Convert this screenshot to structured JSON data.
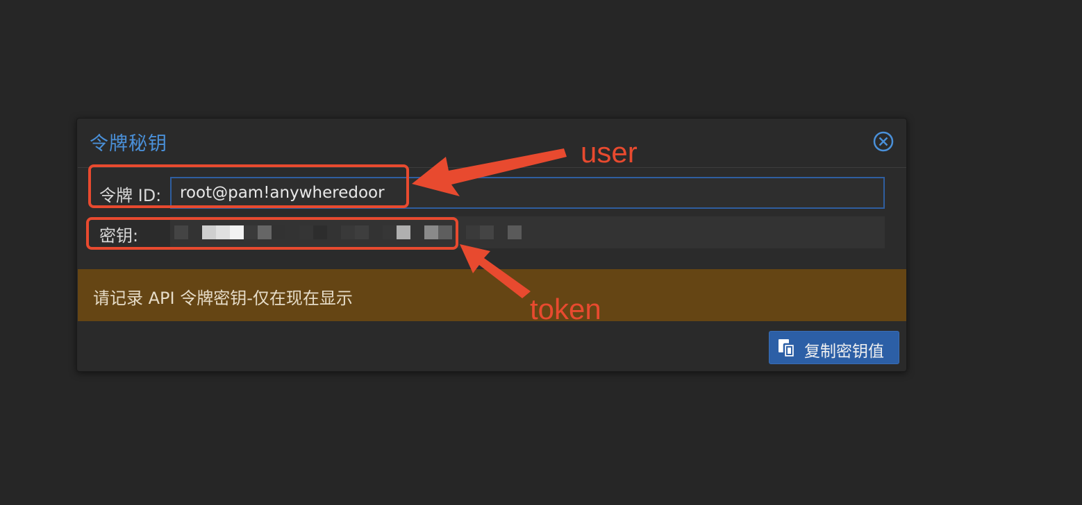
{
  "dialog": {
    "title": "令牌秘钥",
    "close_icon": "circle-x-icon"
  },
  "form": {
    "token_id_label": "令牌 ID:",
    "token_id_value": "root@pam!anywheredoor",
    "secret_label": "密钥:",
    "secret_state": "pixelated"
  },
  "warning": {
    "text": "请记录 API 令牌密钥-仅在现在显示",
    "color": "#654514"
  },
  "footer": {
    "copy_button_label": "复制密钥值",
    "copy_icon": "copy-icon",
    "button_color": "#2c5fa6"
  },
  "annotations": {
    "user_label": "user",
    "token_label": "token",
    "color": "#e84a2f"
  }
}
